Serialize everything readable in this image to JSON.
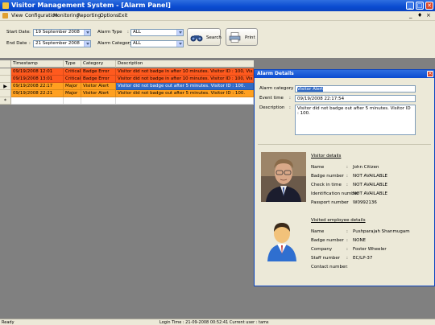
{
  "window": {
    "title": "Visitor Management System - [Alarm Panel]",
    "controls": {
      "minimize": "_",
      "maximize": "□",
      "close": "✕"
    }
  },
  "menu": {
    "items": [
      "View",
      "Configuration",
      "Monitoring",
      "Reporting",
      "Options",
      "Exit"
    ],
    "mdi_controls": {
      "minimize": "_",
      "restore": "♦",
      "close": "×"
    }
  },
  "filters": {
    "start_date": {
      "label": "Start Date",
      "value": "19 September 2008"
    },
    "end_date": {
      "label": "End Date",
      "value": "21 September 2008"
    },
    "alarm_type": {
      "label": "Alarm Type",
      "value": "ALL"
    },
    "alarm_category": {
      "label": "Alarm Category",
      "value": "ALL"
    },
    "colon": ":",
    "search_label": "Search",
    "print_label": "Print"
  },
  "grid": {
    "columns": [
      "Timestamp",
      "Type",
      "Category",
      "Description"
    ],
    "rows": [
      {
        "timestamp": "09/19/2008 12:01",
        "type": "Critical",
        "category": "Badge Error",
        "description": "Visitor did not badge in after 10 minutes. Visitor ID : 100, Visitor Name : Stanley Hill",
        "color": "#ff5a1e",
        "marker": ""
      },
      {
        "timestamp": "09/19/2008 13:01",
        "type": "Critical",
        "category": "Badge Error",
        "description": "Visitor did not badge in after 10 minutes. Visitor ID : 100, Visitor Name : Stanley Hill",
        "color": "#ff5a1e",
        "marker": ""
      },
      {
        "timestamp": "09/19/2008 22:17",
        "type": "Major",
        "category": "Visitor Alert",
        "description": "Visitor did not badge out after 5 minutes. Visitor ID : 100.",
        "color": "#ffa020",
        "marker": "▶"
      },
      {
        "timestamp": "09/19/2008 22:21",
        "type": "Major",
        "category": "Visitor Alert",
        "description": "Visitor did not badge out after 5 minutes. Visitor ID : 100.",
        "color": "#ffa020",
        "marker": ""
      }
    ],
    "new_row_marker": "*"
  },
  "alarm_details": {
    "title": "Alarm Details",
    "close": "×",
    "colon": ":",
    "category_label": "Alarm category",
    "category_value": "Visitor Alert",
    "event_time_label": "Event time",
    "event_time_value": "09/19/2008 22:17:54",
    "description_label": "Description",
    "description_value": "Visitor did not badge out after 5 minutes. Visitor ID : 100.",
    "visitor": {
      "section_title": "Visitor details",
      "fields": [
        {
          "label": "Name",
          "value": "John Citizen"
        },
        {
          "label": "Badge number",
          "value": "NOT AVAILABLE"
        },
        {
          "label": "Check in time",
          "value": "NOT AVAILABLE"
        },
        {
          "label": "Identification number",
          "value": "NOT AVAILABLE"
        },
        {
          "label": "Passport number",
          "value": "W0992136"
        }
      ]
    },
    "employee": {
      "section_title": "Visited employee details",
      "fields": [
        {
          "label": "Name",
          "value": "Pushparajah Shanmugam"
        },
        {
          "label": "Badge number",
          "value": "NONE"
        },
        {
          "label": "Company",
          "value": "Foster Wheeler"
        },
        {
          "label": "Staff number",
          "value": "EC/LP-37"
        },
        {
          "label": "Contact number",
          "value": ""
        }
      ]
    }
  },
  "status": {
    "left": "Ready",
    "center": "Login Time : 21-09-2008 00:52:41  Current user : tams"
  }
}
